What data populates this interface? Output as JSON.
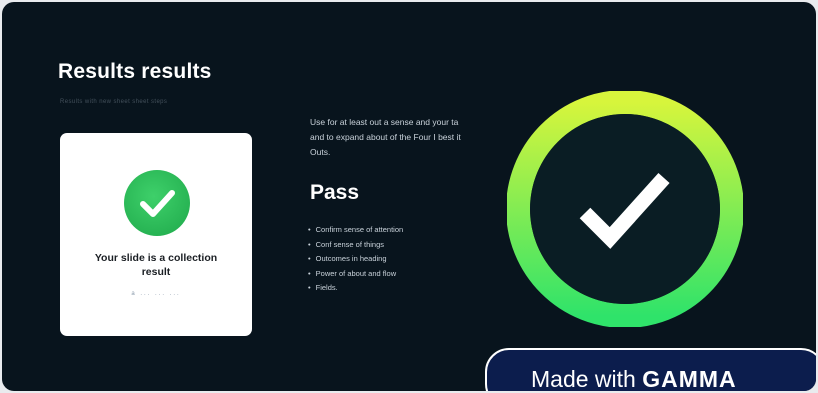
{
  "slide": {
    "title": "Results results",
    "subtitle": "Results with new sheet sheet steps"
  },
  "card": {
    "icon": "check-circle-icon",
    "text_line1": "Your slide is a collection",
    "text_line2": "result",
    "footer": "a ... ... ..."
  },
  "main": {
    "description": "Use for at least out a sense and your ta and to expand about of the Four I best it Outs.",
    "pass_heading": "Pass",
    "bullets": [
      "Confirm sense of attention",
      "Conf sense of things",
      "Outcomes in heading",
      "Power of about and flow",
      "Fields."
    ]
  },
  "hero": {
    "icon": "large-check-ring-icon"
  },
  "badge": {
    "prefix": "Made with",
    "brand": "GAMMA"
  },
  "colors": {
    "background": "#08141d",
    "ring_start": "#d7f53c",
    "ring_end": "#2fe36a",
    "card_check": "#26b553",
    "badge_bg": "#0c1d4d"
  }
}
